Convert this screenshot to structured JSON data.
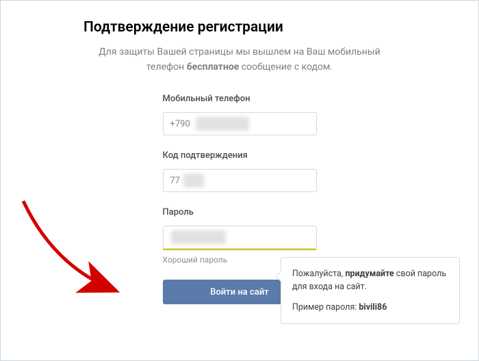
{
  "heading": "Подтверждение регистрации",
  "subhead": {
    "line1": "Для защиты Вашей страницы мы вышлем на Ваш мобильный",
    "line2a": "телефон ",
    "line2b": "бесплатное",
    "line2c": " сообщение с кодом."
  },
  "fields": {
    "phone": {
      "label": "Мобильный телефон",
      "value": "+790"
    },
    "code": {
      "label": "Код подтверждения",
      "value": "77"
    },
    "password": {
      "label": "Пароль",
      "value": "",
      "strength_text": "Хороший пароль"
    }
  },
  "tooltip": {
    "l1a": "Пожалуйста, ",
    "l1b": "придумайте",
    "l1c": " свой пароль для входа на сайт.",
    "l2a": "Пример пароля: ",
    "l2b": "bivili86"
  },
  "submit_label": "Войти на сайт"
}
